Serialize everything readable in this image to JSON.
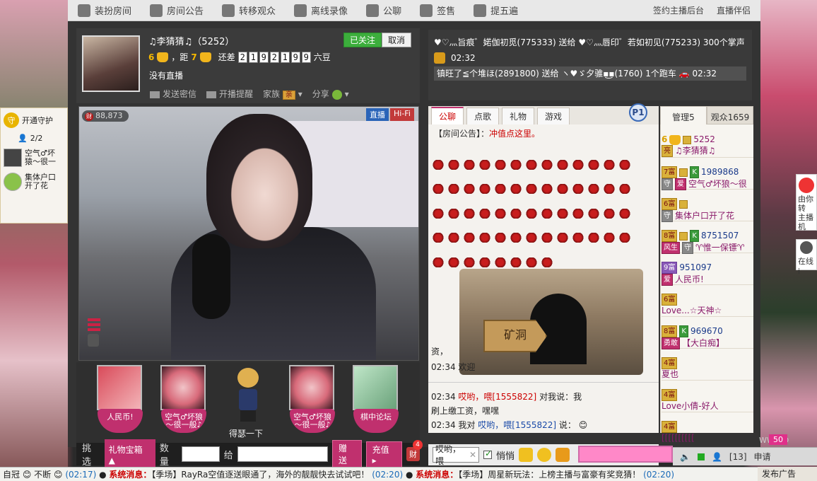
{
  "topbar": {
    "items": [
      "装扮房间",
      "房间公告",
      "转移观众",
      "离线录像",
      "公聊",
      "签售",
      "提五遍"
    ],
    "right": [
      "签约主播后台",
      "直播伴侣"
    ]
  },
  "guard": {
    "title": "开通守护",
    "count": "2/2",
    "members": [
      "空气♂坏\n猿～很一",
      "集体户口\n开了花"
    ]
  },
  "streamer": {
    "name": "♫李猜猜♫（5252）",
    "level_from": "6",
    "level_to": "7",
    "distance_label": "，距",
    "still_need": "还差",
    "digits": [
      "2",
      "1",
      "9",
      "2",
      "1",
      "9",
      "9"
    ],
    "unit": "六豆",
    "status": "没有直播",
    "followed_label": "已关注",
    "cancel_label": "取消",
    "links": [
      "发送密信",
      "开播提醒",
      "家族",
      "分享"
    ],
    "family_tag": "亲"
  },
  "video": {
    "viewer_badge": "财",
    "viewer_count": "88,873",
    "btn_live": "直播",
    "btn_hifi": "Hi-Fi"
  },
  "gifts": [
    {
      "label": "人民币!"
    },
    {
      "label": "空气♂坏狼\n～很一般♪"
    },
    {
      "label": "空气♂坏狼\n～很一般♪"
    },
    {
      "label": "棋中论坛"
    }
  ],
  "gift_character_label": "得瑟一下",
  "giftbar": {
    "pick": "挑选",
    "box": "礼物宝箱",
    "qty": "数量",
    "to": "给",
    "give": "赠送",
    "recharge": "充值",
    "wealth": "财",
    "wealth_count": "4"
  },
  "notice": {
    "line1": "♥♡灬旨痕゛婼伽初觅(775333) 送给 ♥♡灬唇印゛若如初见(775233) 300个掌声",
    "time1": "02:32",
    "line3": "镇旺了≦个堆ほ(2891800) 送给 ヽ♥ゞ夕骓▪͜▪(1760) 1个跑车",
    "time3": "02:32"
  },
  "chat": {
    "tabs": [
      "公聊",
      "点歌",
      "礼物",
      "游戏"
    ],
    "p1": "P1",
    "announce_label": "【房间公告】：",
    "announce_link": "冲值点这里。",
    "sign": "矿洞",
    "msg1_a": "资，",
    "msg2_time": "02:34",
    "msg2_text": "欢迎",
    "msg3_time": "02:34",
    "msg3_name": "哎哟，喂[1555822]",
    "msg3_text": "对我说：我",
    "msg3_cont": "刷上缴工资，嘿嘿",
    "msg4_time": "02:34",
    "msg4_pre": "我对",
    "msg4_name": "哎哟，喂[1555822]",
    "msg4_text": "说："
  },
  "chatinput": {
    "value": "哎哟，喂",
    "whisper": "悄悄"
  },
  "users": {
    "tab_admin": "管理5",
    "tab_viewers": "观众1659",
    "rows": [
      {
        "lvl": "6",
        "num": "5252",
        "tag": "亮",
        "name": "♫李猜猜♫"
      },
      {
        "lvl": "7富",
        "num": "1989868",
        "tag": "",
        "name": "空气♂坏狼～很"
      },
      {
        "lvl": "6富",
        "num": "",
        "tag": "",
        "name": "集体户口开了花"
      },
      {
        "lvl": "8富",
        "num": "8751507",
        "tag": "风生",
        "name": "♈惟一保镖♈"
      },
      {
        "lvl": "9富",
        "num": "951097",
        "tag": "",
        "name": "人民币!"
      },
      {
        "lvl": "6富",
        "num": "",
        "tag": "",
        "name": "Love...☆天神☆"
      },
      {
        "lvl": "8富",
        "num": "969670",
        "tag": "勇敢",
        "name": "【大白痴】"
      },
      {
        "lvl": "4富",
        "num": "",
        "tag": "",
        "name": "夏也"
      },
      {
        "lvl": "4富",
        "num": "",
        "tag": "",
        "name": "Love小倩-好人"
      },
      {
        "lvl": "4富",
        "num": "",
        "tag": "",
        "name": "[[[[[[[[[["
      }
    ]
  },
  "statusbar": {
    "count": "[13]",
    "apply": "申请",
    "badge": "50",
    "bg_text": "WW.MO"
  },
  "ticker": {
    "seg1": "自冠",
    "seg2": "不断",
    "time1": "(02:17)",
    "sys1": "系统消息：",
    "msg1": "【季场】RayRa空值逐送眼通了，海外的靓靓快去试试吧！",
    "time2": "(02:20)",
    "sys2": "系统消息：",
    "msg2": "【季场】周星新玩法：上榜主播与富豪有奖竞猜！",
    "time3": "(02:20)",
    "right": "发布广告"
  },
  "right_side": {
    "ad": "由你转\n主播机",
    "service": "在线i"
  }
}
